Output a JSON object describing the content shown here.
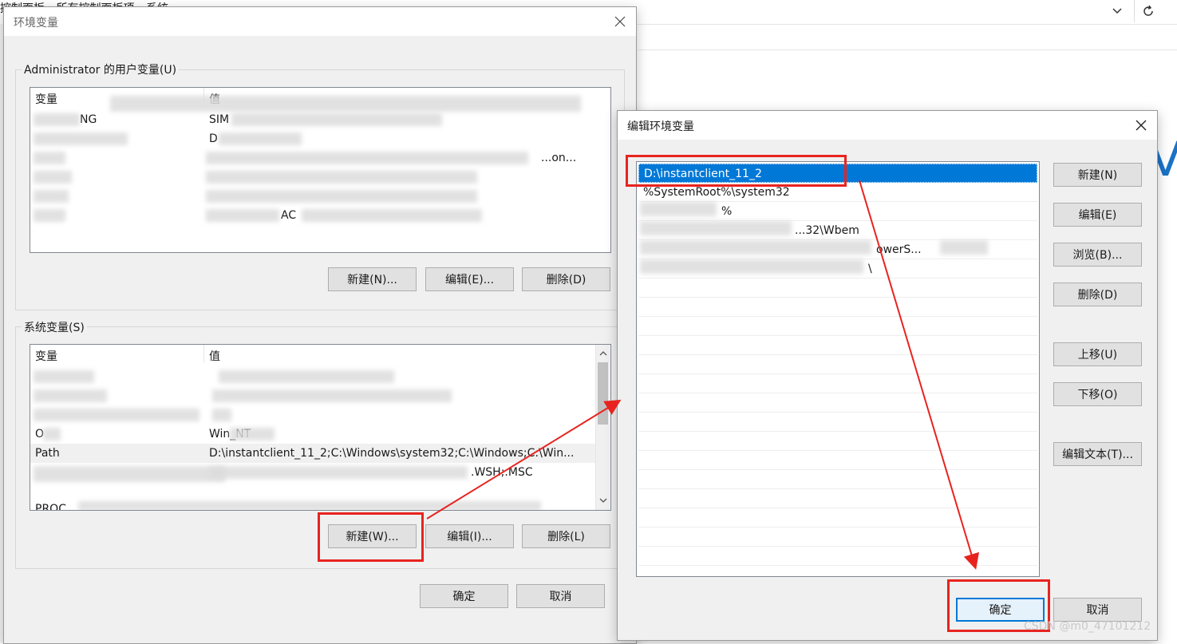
{
  "background": {
    "breadcrumb": "控制面板 › 所有控制面板项 › 系统",
    "brand_fragment": "Vi"
  },
  "env_dialog": {
    "title": "环境变量",
    "user_group": {
      "label": "Administrator 的用户变量(U)",
      "col_var": "变量",
      "col_val": "值",
      "rows": [
        {
          "var": "NG",
          "val": "SIM"
        },
        {
          "var": "",
          "val": "D"
        },
        {
          "var": "",
          "val": "...on..."
        },
        {
          "var": "",
          "val": ""
        },
        {
          "var": "",
          "val": ""
        },
        {
          "var": "",
          "val": "AC"
        }
      ],
      "buttons": {
        "new": "新建(N)...",
        "edit": "编辑(E)...",
        "delete": "删除(D)"
      }
    },
    "system_group": {
      "label": "系统变量(S)",
      "col_var": "变量",
      "col_val": "值",
      "rows": [
        {
          "var": "",
          "val": ""
        },
        {
          "var": "",
          "val": ""
        },
        {
          "var": "",
          "val": ""
        },
        {
          "var": "O",
          "val": "Win_NT"
        },
        {
          "var": "Path",
          "val": "D:\\instantclient_11_2;C:\\Windows\\system32;C:\\Windows;C:\\Win..."
        },
        {
          "var": "",
          "val": ".WSH;.MSC"
        },
        {
          "var": "PROC",
          "val": ""
        }
      ],
      "buttons": {
        "new": "新建(W)...",
        "edit": "编辑(I)...",
        "delete": "删除(L)"
      }
    },
    "ok": "确定",
    "cancel": "取消"
  },
  "edit_dialog": {
    "title": "编辑环境变量",
    "entries": [
      "D:\\instantclient_11_2",
      "%SystemRoot%\\system32",
      "%",
      "...32\\Wbem",
      "owerS...",
      "\\"
    ],
    "selected_index": 0,
    "buttons": {
      "new": "新建(N)",
      "edit": "编辑(E)",
      "browse": "浏览(B)...",
      "delete": "删除(D)",
      "move_up": "上移(U)",
      "move_down": "下移(O)",
      "edit_text": "编辑文本(T)..."
    },
    "ok": "确定",
    "cancel": "取消"
  },
  "watermark": "CSDN @m0_47101212",
  "colors": {
    "annotation_red": "#e8231f",
    "selection_blue": "#0078d7",
    "dialog_bg": "#f0f0f0"
  }
}
